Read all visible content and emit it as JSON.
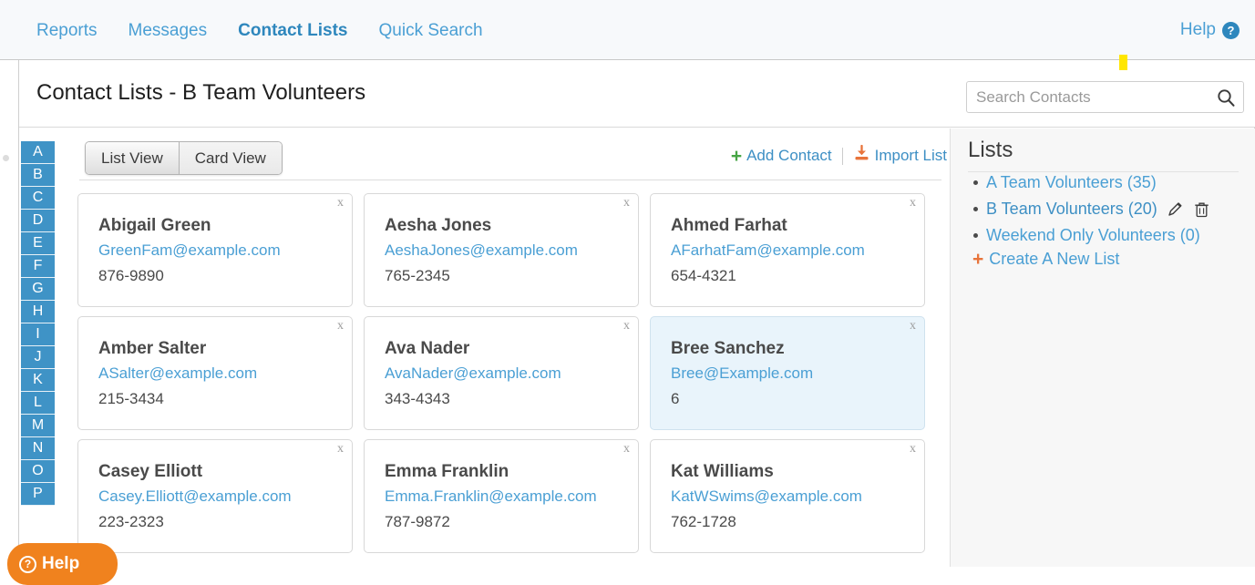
{
  "topnav": {
    "links": [
      {
        "label": "Reports",
        "active": false
      },
      {
        "label": "Messages",
        "active": false
      },
      {
        "label": "Contact Lists",
        "active": true
      },
      {
        "label": "Quick Search",
        "active": false
      }
    ],
    "help_label": "Help",
    "help_badge": "?"
  },
  "header": {
    "title": "Contact Lists - B Team Volunteers",
    "search_placeholder": "Search Contacts",
    "search_value": ""
  },
  "alphabet": [
    "A",
    "B",
    "C",
    "D",
    "E",
    "F",
    "G",
    "H",
    "I",
    "J",
    "K",
    "L",
    "M",
    "N",
    "O",
    "P"
  ],
  "toolbar": {
    "list_view_label": "List View",
    "card_view_label": "Card View",
    "selected_view": "Card View",
    "add_contact_label": "Add Contact",
    "add_contact_plus": "+",
    "import_list_label": "Import List"
  },
  "contacts": [
    {
      "name": "Abigail Green",
      "email": "GreenFam@example.com",
      "phone": "876-9890",
      "close": "x",
      "selected": false
    },
    {
      "name": "Aesha Jones",
      "email": "AeshaJones@example.com",
      "phone": "765-2345",
      "close": "x",
      "selected": false
    },
    {
      "name": "Ahmed Farhat",
      "email": "AFarhatFam@example.com",
      "phone": "654-4321",
      "close": "x",
      "selected": false
    },
    {
      "name": "Amber Salter",
      "email": "ASalter@example.com",
      "phone": "215-3434",
      "close": "x",
      "selected": false
    },
    {
      "name": "Ava Nader",
      "email": "AvaNader@example.com",
      "phone": "343-4343",
      "close": "x",
      "selected": false
    },
    {
      "name": "Bree Sanchez",
      "email": "Bree@Example.com",
      "phone": "6",
      "close": "x",
      "selected": true
    },
    {
      "name": "Casey Elliott",
      "email": "Casey.Elliott@example.com",
      "phone": "223-2323",
      "close": "x",
      "selected": false
    },
    {
      "name": "Emma Franklin",
      "email": "Emma.Franklin@example.com",
      "phone": "787-9872",
      "close": "x",
      "selected": false
    },
    {
      "name": "Kat Williams",
      "email": "KatWSwims@example.com",
      "phone": "762-1728",
      "close": "x",
      "selected": false
    }
  ],
  "lists_panel": {
    "title": "Lists",
    "items": [
      {
        "label": "A Team Volunteers (35)",
        "current": false,
        "has_actions": false
      },
      {
        "label": "B Team Volunteers (20)",
        "current": true,
        "has_actions": true
      },
      {
        "label": "Weekend Only Volunteers (0)",
        "current": false,
        "has_actions": false
      }
    ],
    "create_plus": "+",
    "create_label": "Create A New List"
  },
  "help_fab": {
    "label": "Help",
    "icon_glyph": "?"
  },
  "colors": {
    "accent_blue": "#4a9fd4",
    "rail_blue": "#3f93c6",
    "selected_card": "#e9f4fb",
    "orange": "#f0821e",
    "green_plus": "#46a544",
    "marker_yellow": "#ffe600"
  }
}
